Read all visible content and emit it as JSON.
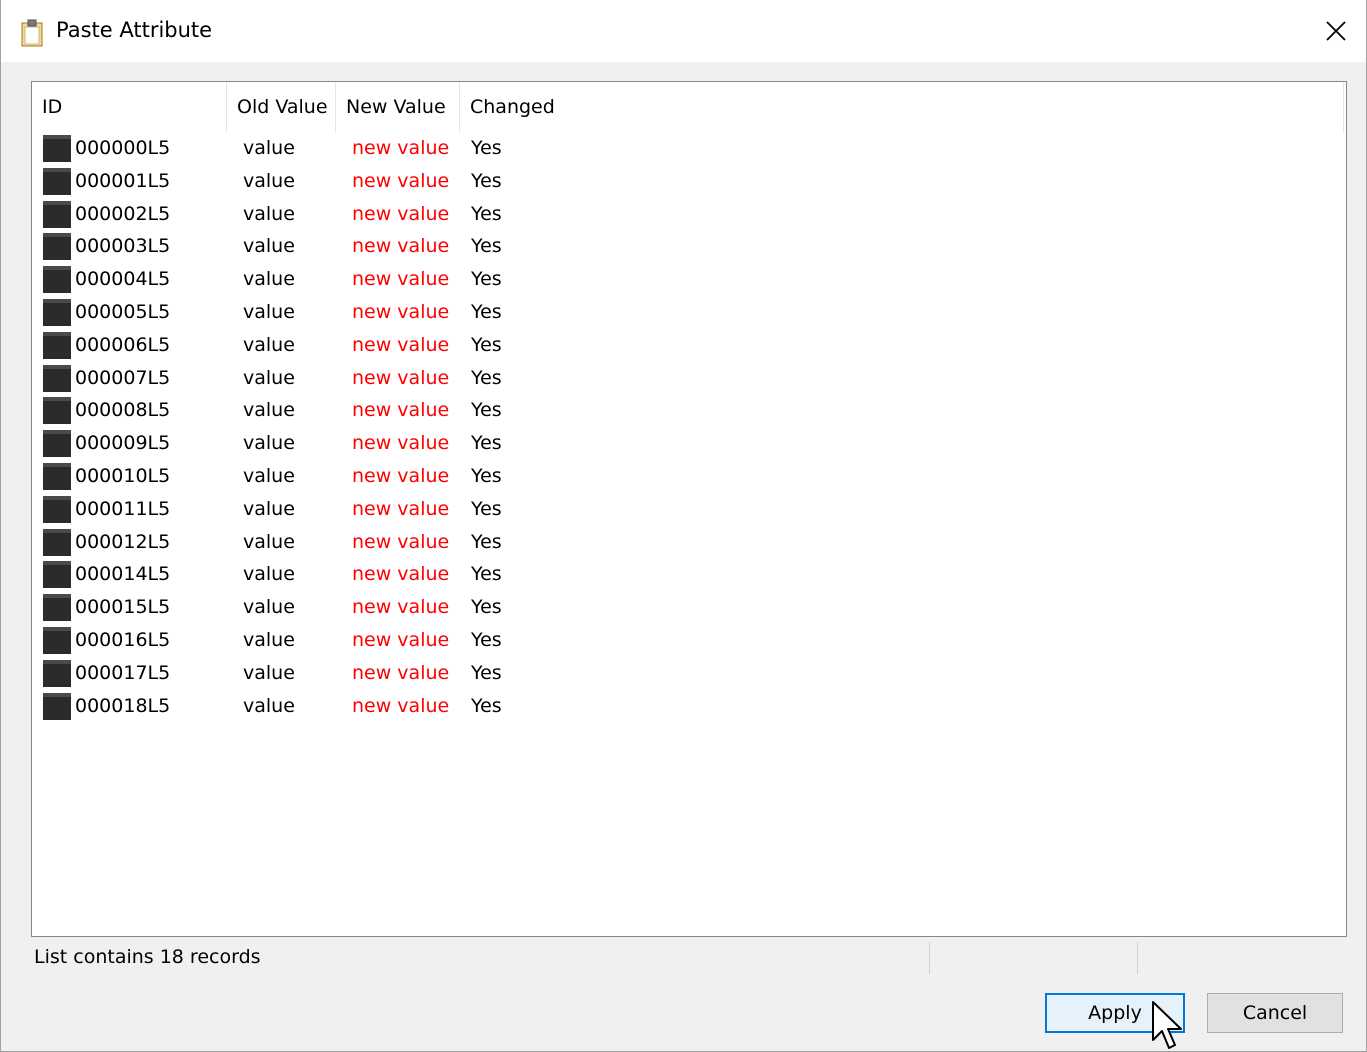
{
  "window": {
    "title": "Paste Attribute",
    "title_icon": "clipboard-icon",
    "close_icon": "close-icon"
  },
  "list": {
    "columns": [
      "ID",
      "Old Value",
      "New Value",
      "Changed"
    ],
    "row_icon": "object-icon",
    "rows": [
      {
        "id": "000000L5",
        "old": "value",
        "new": "new value",
        "changed": "Yes"
      },
      {
        "id": "000001L5",
        "old": "value",
        "new": "new value",
        "changed": "Yes"
      },
      {
        "id": "000002L5",
        "old": "value",
        "new": "new value",
        "changed": "Yes"
      },
      {
        "id": "000003L5",
        "old": "value",
        "new": "new value",
        "changed": "Yes"
      },
      {
        "id": "000004L5",
        "old": "value",
        "new": "new value",
        "changed": "Yes"
      },
      {
        "id": "000005L5",
        "old": "value",
        "new": "new value",
        "changed": "Yes"
      },
      {
        "id": "000006L5",
        "old": "value",
        "new": "new value",
        "changed": "Yes"
      },
      {
        "id": "000007L5",
        "old": "value",
        "new": "new value",
        "changed": "Yes"
      },
      {
        "id": "000008L5",
        "old": "value",
        "new": "new value",
        "changed": "Yes"
      },
      {
        "id": "000009L5",
        "old": "value",
        "new": "new value",
        "changed": "Yes"
      },
      {
        "id": "000010L5",
        "old": "value",
        "new": "new value",
        "changed": "Yes"
      },
      {
        "id": "000011L5",
        "old": "value",
        "new": "new value",
        "changed": "Yes"
      },
      {
        "id": "000012L5",
        "old": "value",
        "new": "new value",
        "changed": "Yes"
      },
      {
        "id": "000014L5",
        "old": "value",
        "new": "new value",
        "changed": "Yes"
      },
      {
        "id": "000015L5",
        "old": "value",
        "new": "new value",
        "changed": "Yes"
      },
      {
        "id": "000016L5",
        "old": "value",
        "new": "new value",
        "changed": "Yes"
      },
      {
        "id": "000017L5",
        "old": "value",
        "new": "new value",
        "changed": "Yes"
      },
      {
        "id": "000018L5",
        "old": "value",
        "new": "new value",
        "changed": "Yes"
      }
    ],
    "new_value_color": "#ff0000"
  },
  "status": {
    "text": "List contains 18 records"
  },
  "buttons": {
    "apply": "Apply",
    "cancel": "Cancel"
  }
}
